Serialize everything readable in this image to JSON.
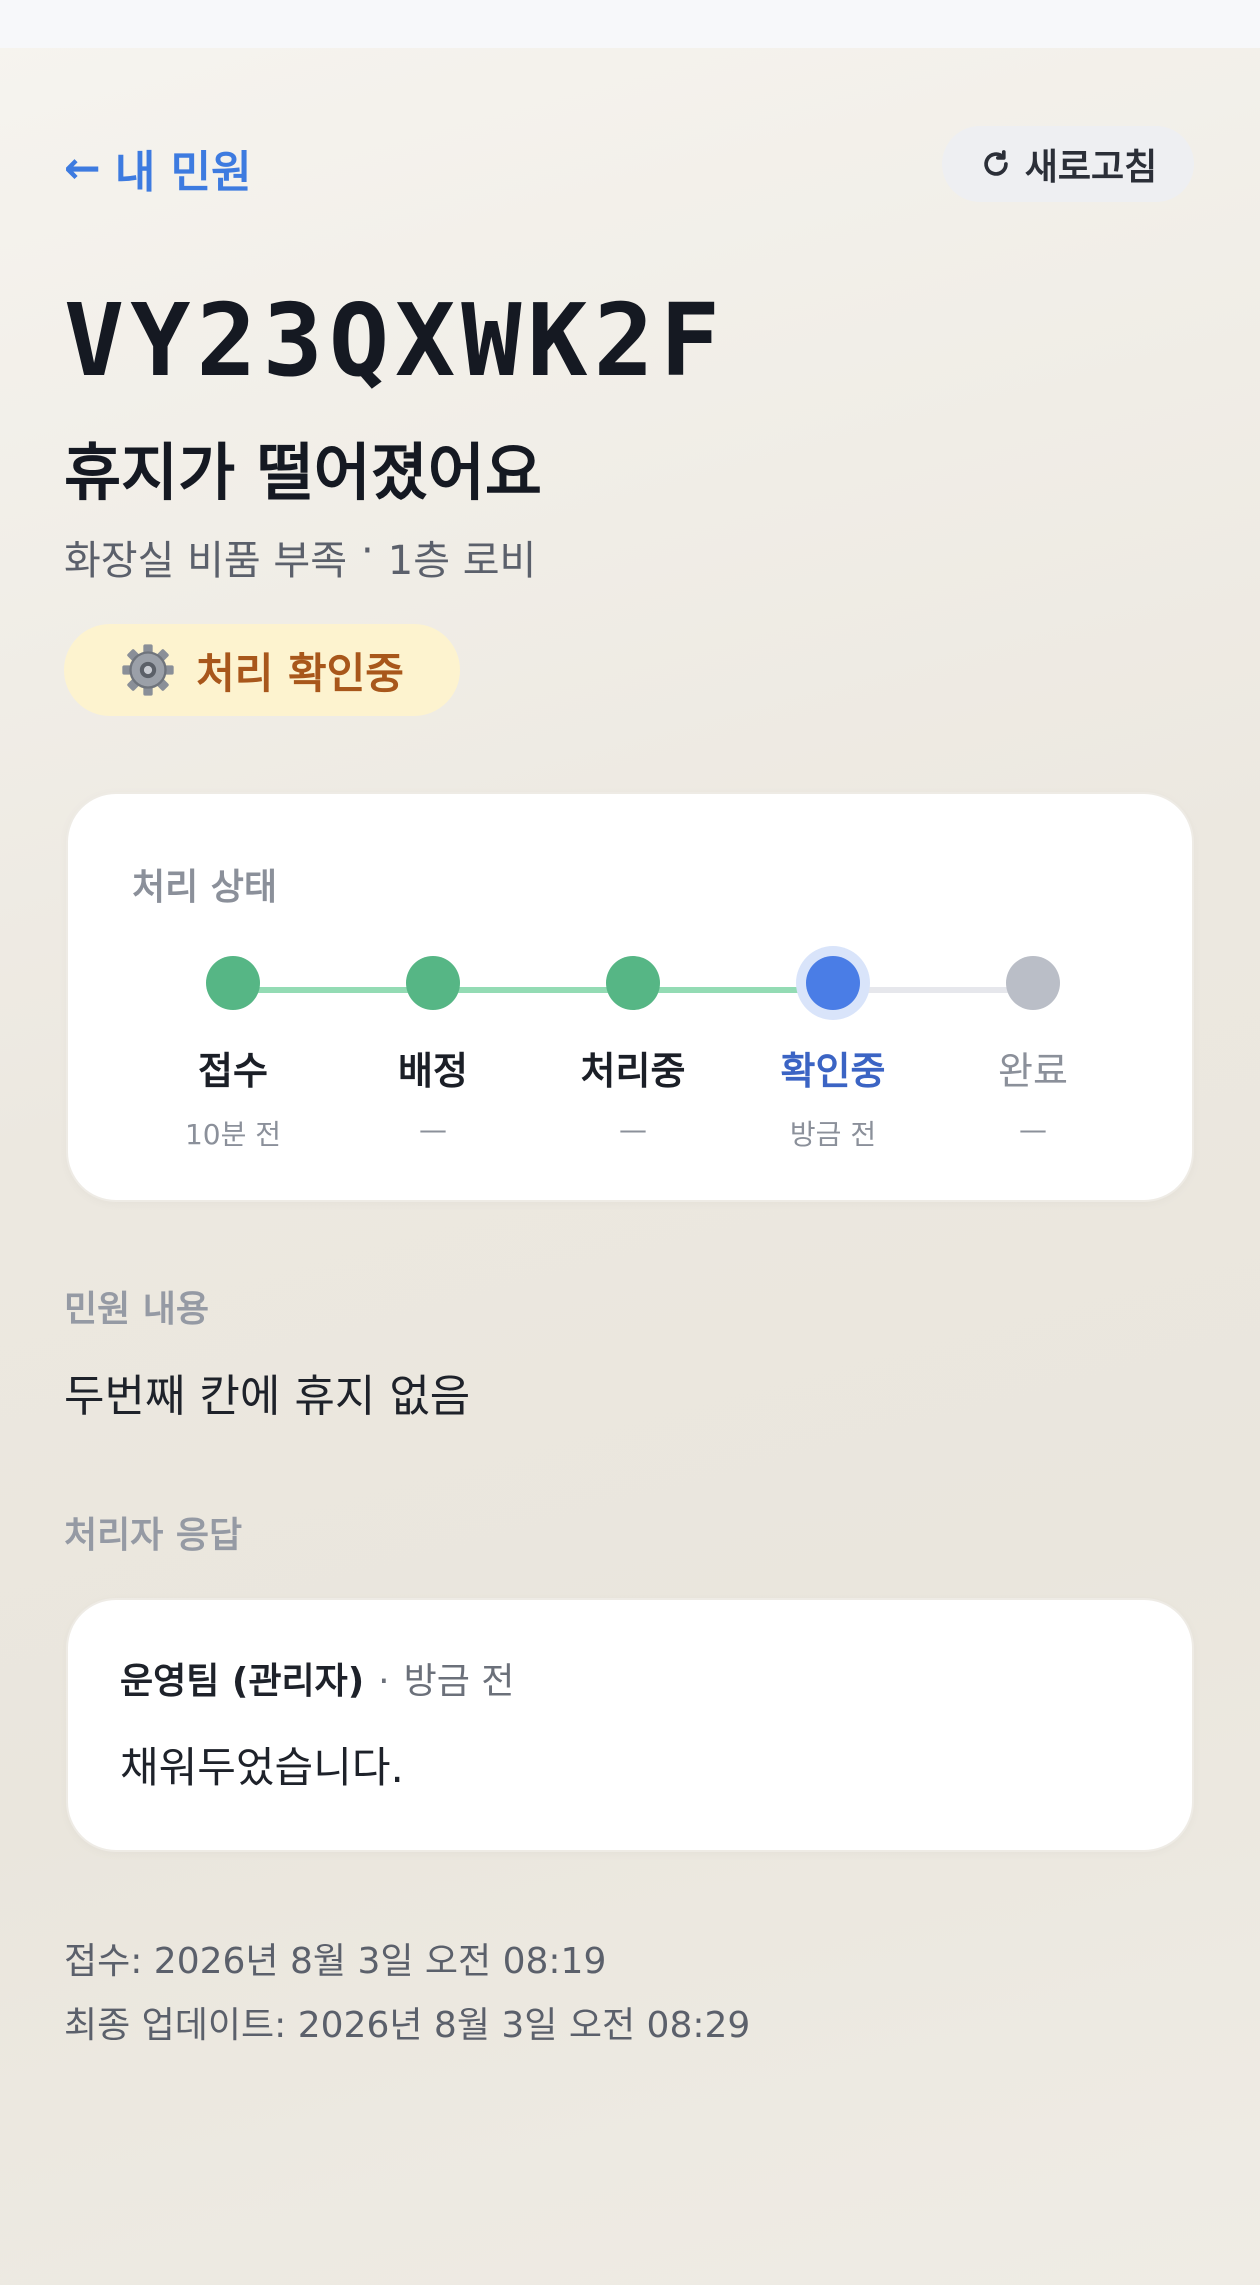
{
  "header": {
    "back_label": "내 민원",
    "refresh_label": "새로고침"
  },
  "ticket": {
    "code": "VY23QXWK2F",
    "title": "휴지가 떨어졌어요",
    "category": "화장실 비품 부족",
    "meta_sep": "·",
    "location": "1층 로비",
    "status_label": "처리 확인중"
  },
  "progress": {
    "label": "처리 상태",
    "steps": [
      {
        "label": "접수",
        "time": "10분 전",
        "state": "done"
      },
      {
        "label": "배정",
        "time": "—",
        "state": "done"
      },
      {
        "label": "처리중",
        "time": "—",
        "state": "done"
      },
      {
        "label": "확인중",
        "time": "방금 전",
        "state": "current"
      },
      {
        "label": "완료",
        "time": "—",
        "state": "pending"
      }
    ]
  },
  "complaint": {
    "section_label": "민원 내용",
    "text": "두번째 칸에 휴지 없음"
  },
  "reply": {
    "section_label": "처리자 응답",
    "author": "운영팀 (관리자)",
    "sep": "·",
    "when": "방금 전",
    "body": "채워두었습니다."
  },
  "footer": {
    "submitted": "접수: 2026년 8월 3일 오전 08:19",
    "updated": "최종 업데이트: 2026년 8월 3일 오전 08:29"
  },
  "colors": {
    "accent": "#3d7be0",
    "done": "#56b685",
    "current": "#4a7de6",
    "pending": "#babec7",
    "badge_bg": "#fdf3cf",
    "badge_text": "#a8571b"
  }
}
